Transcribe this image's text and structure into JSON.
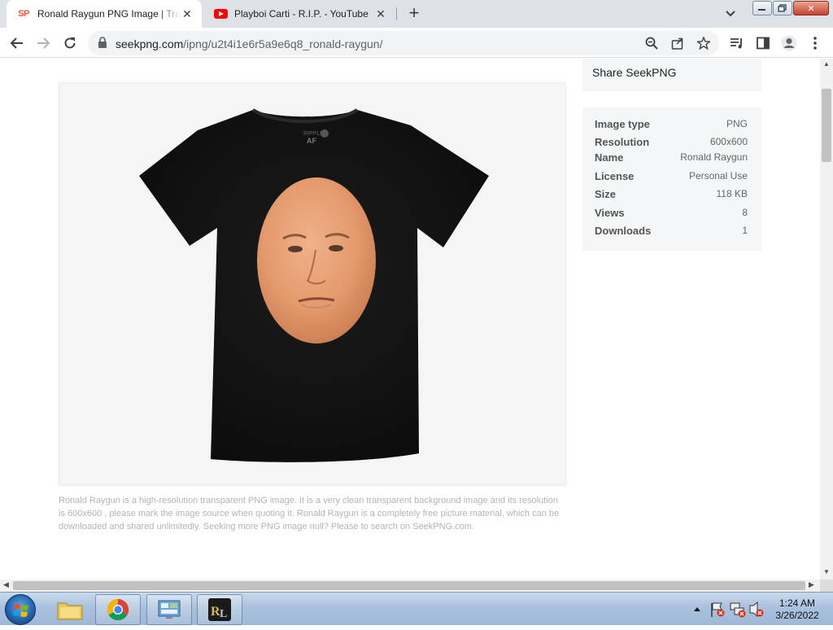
{
  "tabs": [
    {
      "title": "Ronald Raygun PNG Image | Transparent",
      "favicon": "SP",
      "active": true
    },
    {
      "title": "Playboi Carti - R.I.P. - YouTube",
      "favicon": "youtube-icon",
      "active": false
    }
  ],
  "address": {
    "domain": "seekpng.com",
    "path": "/ipng/u2t4i1e6r5a9e6q8_ronald-raygun/"
  },
  "share": {
    "label": "Share SeekPNG"
  },
  "info": [
    {
      "key": "Image type",
      "value": "PNG"
    },
    {
      "key": "Resolution",
      "value": "600x600"
    },
    {
      "key": "Name",
      "value": "Ronald Raygun"
    },
    {
      "key": "License",
      "value": "Personal Use"
    },
    {
      "key": "Size",
      "value": "118 KB"
    },
    {
      "key": "Views",
      "value": "8"
    },
    {
      "key": "Downloads",
      "value": "1"
    }
  ],
  "caption": "Ronald Raygun is a high-resolution transparent PNG image. It is a very clean transparent background image and its resolution is 600x600 , please mark the image source when quoting it. Ronald Raygun is a completely free picture material, which can be downloaded and shared unlimitedly. Seeking more PNG image null? Please to search on SeekPNG.com.",
  "taskbar": {
    "time": "1:24 AM",
    "date": "3/26/2022"
  },
  "colors": {
    "seekpng_brand": "#f2582f",
    "youtube_red": "#ff0000",
    "tab_strip": "#dee1e6",
    "info_bg": "#f5f6f7"
  }
}
